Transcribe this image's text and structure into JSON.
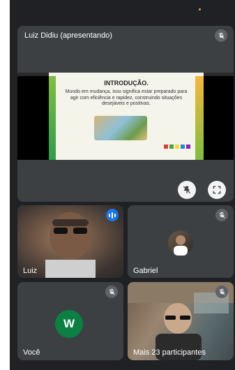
{
  "presenter_tile": {
    "name": "Luiz Didiu (apresentando)",
    "icon": "mic-off-icon"
  },
  "slide": {
    "title": "INTRODUÇÃO.",
    "body": "Mundo em mudança, isso significa estar preparado para agir com eficiência e rapidez, construindo situações desejáveis e positivas."
  },
  "controls": {
    "pin_icon": "pin-off-icon",
    "fullscreen_icon": "fullscreen-icon"
  },
  "participants": [
    {
      "name": "Luiz",
      "status_icon": "speaking-indicator-icon"
    },
    {
      "name": "Gabriel",
      "status_icon": "mic-off-icon"
    },
    {
      "name": "Você",
      "avatar_letter": "W",
      "avatar_color": "#0b8043",
      "status_icon": "mic-off-icon"
    },
    {
      "name": "Mais 23 participantes",
      "status_icon": "mic-off-icon"
    }
  ],
  "colors": {
    "background": "#202124",
    "tile": "#3c4043",
    "accent_blue": "#1a73e8"
  }
}
